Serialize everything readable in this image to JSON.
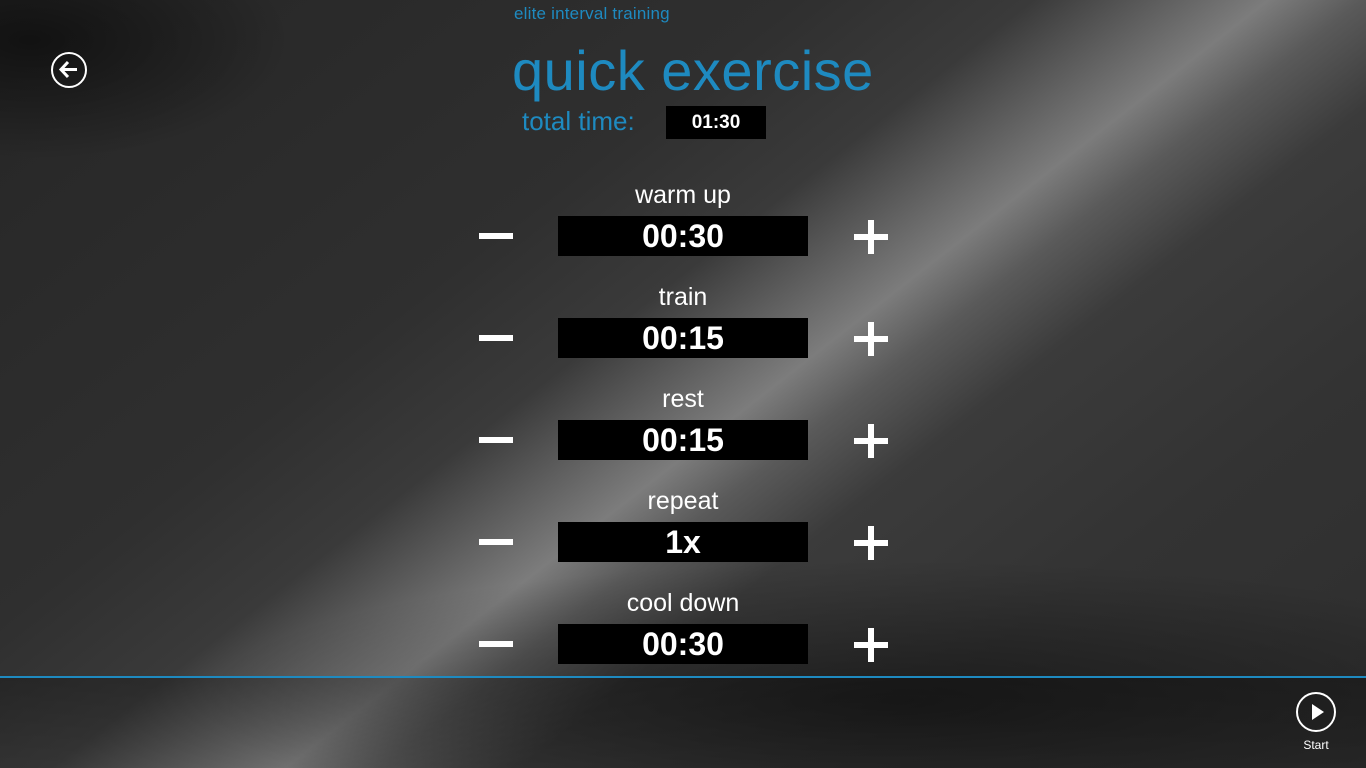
{
  "app": {
    "subtitle": "elite interval training",
    "back_icon": "arrow-left-circle-icon"
  },
  "page": {
    "title": "quick exercise",
    "total_label": "total time:",
    "total_value": "01:30"
  },
  "settings": [
    {
      "label": "warm up",
      "value": "00:30",
      "minus_icon": "minus-icon",
      "plus_icon": "plus-icon"
    },
    {
      "label": "train",
      "value": "00:15",
      "minus_icon": "minus-icon",
      "plus_icon": "plus-icon"
    },
    {
      "label": "rest",
      "value": "00:15",
      "minus_icon": "minus-icon",
      "plus_icon": "plus-icon"
    },
    {
      "label": "repeat",
      "value": "1x",
      "minus_icon": "minus-icon",
      "plus_icon": "plus-icon"
    },
    {
      "label": "cool down",
      "value": "00:30",
      "minus_icon": "minus-icon",
      "plus_icon": "plus-icon"
    }
  ],
  "app_bar": {
    "start_label": "Start",
    "start_icon": "play-circle-icon"
  },
  "colors": {
    "accent": "#1e8ac0",
    "value_background": "#000000",
    "text": "#ffffff"
  }
}
